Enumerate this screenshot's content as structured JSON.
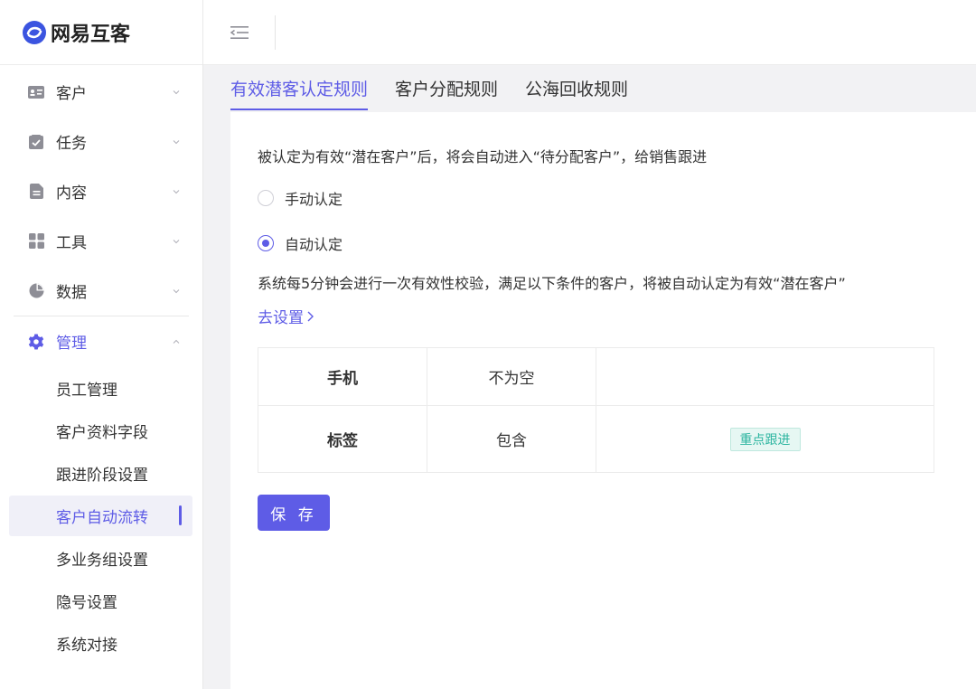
{
  "brand": {
    "name": "网易互客",
    "accent": "#5e5ce6",
    "logo_color": "#3b54e0"
  },
  "sidebar": {
    "items": [
      {
        "label": "客户",
        "icon": "contact-card-icon"
      },
      {
        "label": "任务",
        "icon": "task-icon"
      },
      {
        "label": "内容",
        "icon": "document-icon"
      },
      {
        "label": "工具",
        "icon": "grid-icon"
      },
      {
        "label": "数据",
        "icon": "pie-chart-icon"
      },
      {
        "label": "管理",
        "icon": "gear-icon"
      }
    ],
    "sub_items": [
      {
        "label": "员工管理"
      },
      {
        "label": "客户资料字段"
      },
      {
        "label": "跟进阶段设置"
      },
      {
        "label": "客户自动流转"
      },
      {
        "label": "多业务组设置"
      },
      {
        "label": "隐号设置"
      },
      {
        "label": "系统对接"
      }
    ]
  },
  "tabs": [
    {
      "label": "有效潜客认定规则"
    },
    {
      "label": "客户分配规则"
    },
    {
      "label": "公海回收规则"
    }
  ],
  "main": {
    "description": "被认定为有效“潜在客户”后，将会自动进入“待分配客户”，给销售跟进",
    "radio_manual": "手动认定",
    "radio_auto": "自动认定",
    "system_desc": "系统每5分钟会进行一次有效性校验，满足以下条件的客户，将被自动认定为有效“潜在客户”",
    "go_set": "去设置",
    "rules": [
      {
        "field": "手机",
        "op": "不为空",
        "value": ""
      },
      {
        "field": "标签",
        "op": "包含",
        "value": "重点跟进"
      }
    ],
    "save_label": "保 存"
  }
}
